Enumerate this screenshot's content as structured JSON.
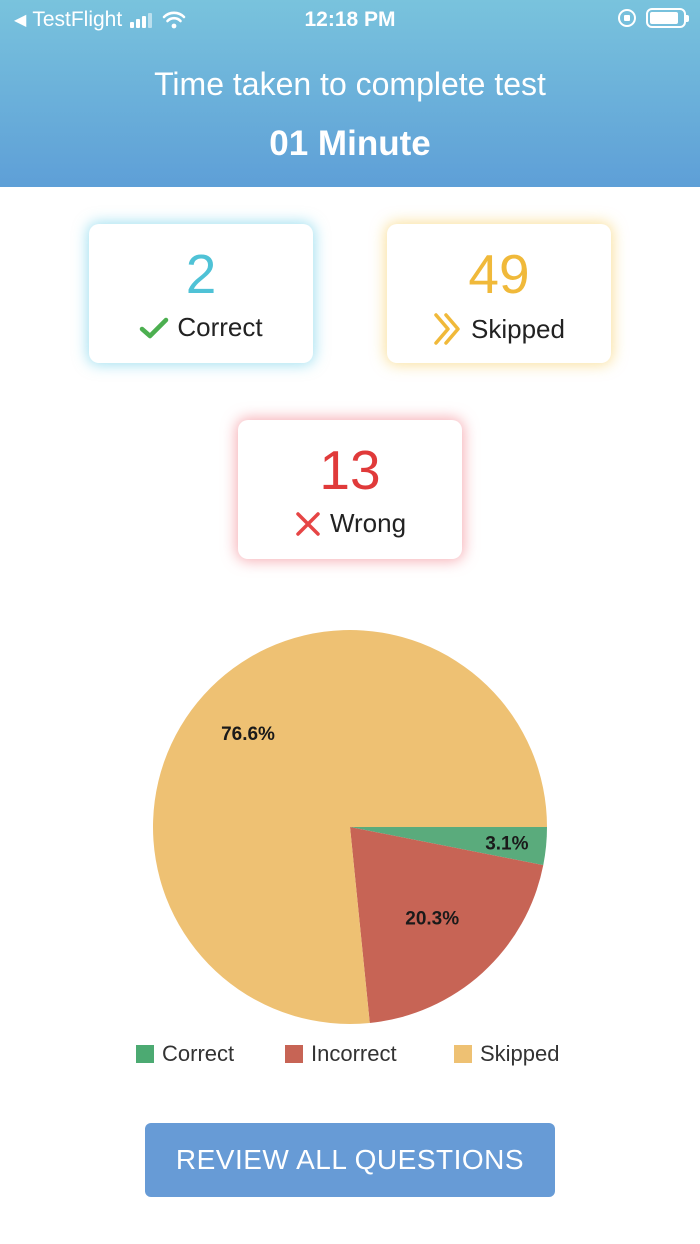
{
  "status_bar": {
    "back_app": "TestFlight",
    "time": "12:18 PM"
  },
  "header": {
    "title": "Time taken to complete test",
    "value": "01 Minute"
  },
  "stats": {
    "correct": {
      "value": "2",
      "label": "Correct",
      "color": "#4fc2d6",
      "icon": "check-icon"
    },
    "skipped": {
      "value": "49",
      "label": "Skipped",
      "color": "#f0b93a",
      "icon": "double-chevron-right-icon"
    },
    "wrong": {
      "value": "13",
      "label": "Wrong",
      "color": "#e03a3a",
      "icon": "close-icon"
    }
  },
  "chart_data": {
    "type": "pie",
    "slices": [
      {
        "name": "Correct",
        "value": 3.1,
        "label": "3.1%",
        "color": "#5aab7c"
      },
      {
        "name": "Incorrect",
        "value": 20.3,
        "label": "20.3%",
        "color": "#c76455"
      },
      {
        "name": "Skipped",
        "value": 76.6,
        "label": "76.6%",
        "color": "#eec173"
      }
    ],
    "legend": [
      "Correct",
      "Incorrect",
      "Skipped"
    ],
    "legend_position": "bottom"
  },
  "review_button": {
    "label": "REVIEW ALL QUESTIONS"
  }
}
